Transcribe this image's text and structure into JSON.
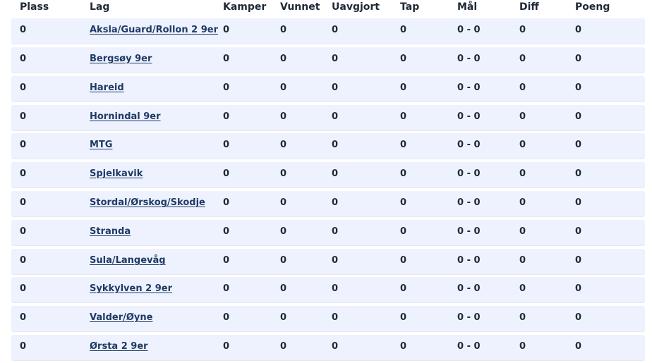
{
  "columns": {
    "plass": "Plass",
    "lag": "Lag",
    "kamper": "Kamper",
    "vunnet": "Vunnet",
    "uavgjort": "Uavgjort",
    "tap": "Tap",
    "mal": "Mål",
    "diff": "Diff",
    "poeng": "Poeng"
  },
  "rows": [
    {
      "plass": "0",
      "lag": "Aksla/Guard/Rollon 2 9er",
      "kamper": "0",
      "vunnet": "0",
      "uavgjort": "0",
      "tap": "0",
      "mal": "0 - 0",
      "diff": "0",
      "poeng": "0"
    },
    {
      "plass": "0",
      "lag": "Bergsøy 9er",
      "kamper": "0",
      "vunnet": "0",
      "uavgjort": "0",
      "tap": "0",
      "mal": "0 - 0",
      "diff": "0",
      "poeng": "0"
    },
    {
      "plass": "0",
      "lag": "Hareid",
      "kamper": "0",
      "vunnet": "0",
      "uavgjort": "0",
      "tap": "0",
      "mal": "0 - 0",
      "diff": "0",
      "poeng": "0"
    },
    {
      "plass": "0",
      "lag": "Hornindal 9er",
      "kamper": "0",
      "vunnet": "0",
      "uavgjort": "0",
      "tap": "0",
      "mal": "0 - 0",
      "diff": "0",
      "poeng": "0"
    },
    {
      "plass": "0",
      "lag": "MTG",
      "kamper": "0",
      "vunnet": "0",
      "uavgjort": "0",
      "tap": "0",
      "mal": "0 - 0",
      "diff": "0",
      "poeng": "0"
    },
    {
      "plass": "0",
      "lag": "Spjelkavik",
      "kamper": "0",
      "vunnet": "0",
      "uavgjort": "0",
      "tap": "0",
      "mal": "0 - 0",
      "diff": "0",
      "poeng": "0"
    },
    {
      "plass": "0",
      "lag": "Stordal/Ørskog/Skodje",
      "kamper": "0",
      "vunnet": "0",
      "uavgjort": "0",
      "tap": "0",
      "mal": "0 - 0",
      "diff": "0",
      "poeng": "0"
    },
    {
      "plass": "0",
      "lag": "Stranda",
      "kamper": "0",
      "vunnet": "0",
      "uavgjort": "0",
      "tap": "0",
      "mal": "0 - 0",
      "diff": "0",
      "poeng": "0"
    },
    {
      "plass": "0",
      "lag": "Sula/Langevåg",
      "kamper": "0",
      "vunnet": "0",
      "uavgjort": "0",
      "tap": "0",
      "mal": "0 - 0",
      "diff": "0",
      "poeng": "0"
    },
    {
      "plass": "0",
      "lag": "Sykkylven 2 9er",
      "kamper": "0",
      "vunnet": "0",
      "uavgjort": "0",
      "tap": "0",
      "mal": "0 - 0",
      "diff": "0",
      "poeng": "0"
    },
    {
      "plass": "0",
      "lag": "Valder/Øyne",
      "kamper": "0",
      "vunnet": "0",
      "uavgjort": "0",
      "tap": "0",
      "mal": "0 - 0",
      "diff": "0",
      "poeng": "0"
    },
    {
      "plass": "0",
      "lag": "Ørsta 2 9er",
      "kamper": "0",
      "vunnet": "0",
      "uavgjort": "0",
      "tap": "0",
      "mal": "0 - 0",
      "diff": "0",
      "poeng": "0"
    }
  ],
  "colors": {
    "row_background": "#eef2fe",
    "link": "#1e3a66",
    "text": "#1f2937"
  }
}
